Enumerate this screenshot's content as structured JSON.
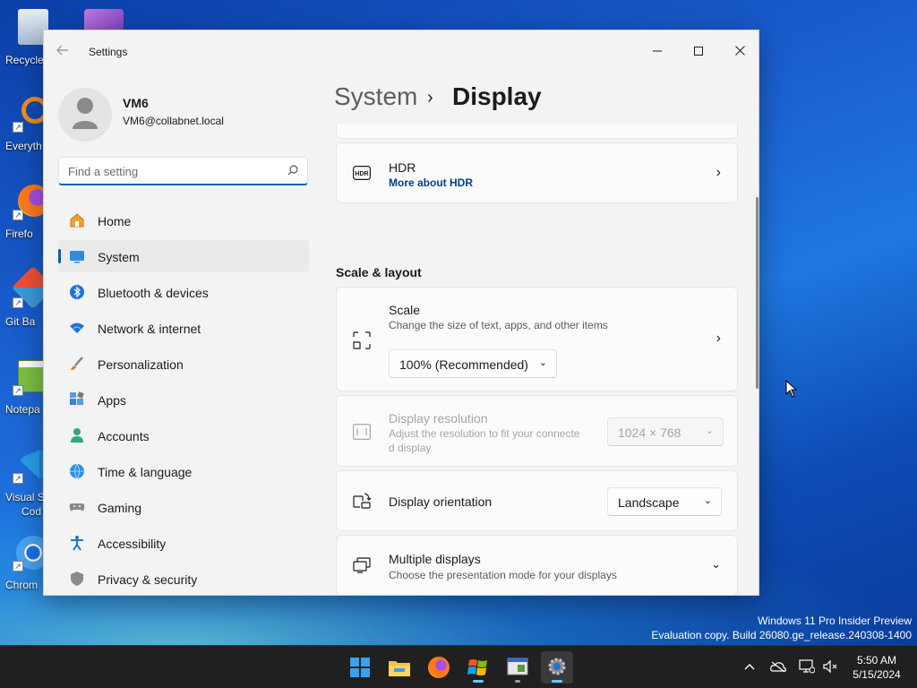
{
  "desktop": {
    "icons": [
      {
        "label": "Recycle",
        "name": "recycle-bin-icon"
      },
      {
        "label": "Everyth",
        "name": "everything-search-icon"
      },
      {
        "label": "Firefo",
        "name": "firefox-icon"
      },
      {
        "label": "Git Ba",
        "name": "git-bash-icon"
      },
      {
        "label": "Notepa",
        "name": "notepad-icon"
      },
      {
        "label": "Visual St",
        "name": "vscode-icon"
      },
      {
        "label": "Chrom",
        "name": "chrome-icon"
      }
    ],
    "label_vscode_line2": "Cod",
    "watermark_line1": "Windows 11 Pro Insider Preview",
    "watermark_line2": "Evaluation copy. Build 26080.ge_release.240308-1400"
  },
  "window": {
    "title": "Settings",
    "controls": {
      "minimize": "—",
      "maximize": "▢",
      "close": "✕"
    }
  },
  "profile": {
    "name": "VM6",
    "email": "VM6@collabnet.local"
  },
  "search": {
    "placeholder": "Find a setting"
  },
  "nav": {
    "items": [
      {
        "label": "Home",
        "icon": "home-icon"
      },
      {
        "label": "System",
        "icon": "system-icon",
        "active": true
      },
      {
        "label": "Bluetooth & devices",
        "icon": "bluetooth-icon"
      },
      {
        "label": "Network & internet",
        "icon": "wifi-icon"
      },
      {
        "label": "Personalization",
        "icon": "brush-icon"
      },
      {
        "label": "Apps",
        "icon": "apps-icon"
      },
      {
        "label": "Accounts",
        "icon": "accounts-icon"
      },
      {
        "label": "Time & language",
        "icon": "globe-icon"
      },
      {
        "label": "Gaming",
        "icon": "gamepad-icon"
      },
      {
        "label": "Accessibility",
        "icon": "accessibility-icon"
      },
      {
        "label": "Privacy & security",
        "icon": "shield-icon"
      }
    ]
  },
  "breadcrumb": {
    "parent": "System",
    "separator": "›",
    "current": "Display"
  },
  "hdr": {
    "title": "HDR",
    "link": "More about HDR"
  },
  "scale_layout": {
    "header": "Scale & layout",
    "scale": {
      "title": "Scale",
      "subtitle": "Change the size of text, apps, and other items",
      "value": "100% (Recommended)"
    },
    "resolution": {
      "title": "Display resolution",
      "subtitle_line1": "Adjust the resolution to fit your connecte",
      "subtitle_line2": "d display",
      "value": "1024 × 768",
      "disabled": true
    },
    "orientation": {
      "title": "Display orientation",
      "value": "Landscape"
    },
    "multiple": {
      "title": "Multiple displays",
      "subtitle": "Choose the presentation mode for your displays"
    }
  },
  "taskbar": {
    "apps": [
      "start-icon",
      "file-explorer-icon",
      "firefox-icon",
      "windows-flag-icon",
      "terminal-icon",
      "settings-icon"
    ],
    "active_app": "settings-icon",
    "tray": [
      "chevron-up-icon",
      "onedrive-icon",
      "monitor-icon",
      "volume-icon"
    ],
    "time": "5:50 AM",
    "date": "5/15/2024"
  },
  "colors": {
    "accent": "#005fb8",
    "link": "#003e92",
    "taskbar_indicator": "#60cdff"
  }
}
